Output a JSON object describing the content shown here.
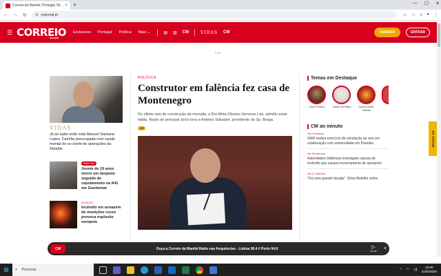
{
  "browser": {
    "tab_title": "Correio da Manhã: Portugal, Ni...",
    "url": "cmjornal.pt",
    "new_tab": "+",
    "tab_close": "×"
  },
  "header": {
    "logo": "CORREIO",
    "logo_sub": "da manhã",
    "nav": [
      "Exclusivos",
      "Portugal",
      "Política",
      "Mais"
    ],
    "assinar": "ASSINAR",
    "entrar": "ENTRAR",
    "vidas": "VIDAS",
    "cm_short": "CM",
    "brand_color": "#d8001f"
  },
  "pub": "PUB",
  "left": {
    "vidas_label": "VIDAS",
    "vidas_text": "Já se sabe onde está Manuel Santana Lopes. Família preocupada com saúde mental do ex-chefe de operações da Notable",
    "item1_badge": "Rádio CM",
    "item1_title": "Jovem de 19 anos morre em despiste seguido de capotamento na A41 em Gondomar",
    "item2_section": "MUNDO",
    "item2_title": "Incêndio em armazém de munições russo provoca explosão europeia"
  },
  "main": {
    "section": "POLÍTICA",
    "headline": "Construtor em falência fez casa de Montenegro",
    "lead": "Do último ano de construção da moradia, a Rui Mota Oliveira Services Lda. admitiu estar falida. Rasto do principal sócio leva a António Salvador, presidente do Sp. Braga.",
    "badge": "CM"
  },
  "right": {
    "temas_title": "Temas em Destaque",
    "temas": [
      {
        "label": "Crise Política"
      },
      {
        "label": "Saúde do Papa"
      },
      {
        "label": "Guerra Israel-Hamas"
      }
    ],
    "minuto_title": "CM ao minuto",
    "news": [
      {
        "time": "Há 9 minutos",
        "text": "GNR realiza exercício de simulação ao vivo em colaboração com universidade em Paredes"
      },
      {
        "time": "Há 18 minutos",
        "text": "Autoridades britânicas investigam causas de incêndio que causou encerramento de aeroporto"
      },
      {
        "time": "Há 21 minutos",
        "text": "\"Foi uma grande facada\": Sílvia Botelho sobre"
      }
    ]
  },
  "recebe": "RECEBA 25€",
  "radio": {
    "logo": "CM",
    "text": "Ouça a Correio da Manhã Rádio nas frequências - Lisboa 90.4 // Porto 94.8",
    "play_label": "OUVIR",
    "close": "×"
  },
  "taskbar": {
    "search": "Procurar",
    "time": "15:09",
    "date": "21/03/2025"
  }
}
